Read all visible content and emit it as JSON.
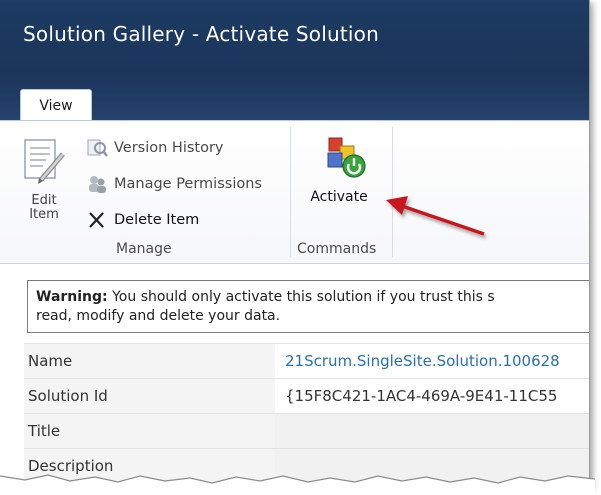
{
  "header": {
    "title": "Solution Gallery - Activate Solution",
    "active_tab": "View"
  },
  "ribbon": {
    "manage_group": {
      "edit_item_label": "Edit Item",
      "version_history_label": "Version History",
      "manage_permissions_label": "Manage Permissions",
      "delete_item_label": "Delete Item",
      "group_label": "Manage"
    },
    "commands_group": {
      "activate_label": "Activate",
      "group_label": "Commands"
    }
  },
  "warning": {
    "prefix": "Warning:",
    "line1": " You should only activate this solution if you trust this s",
    "line2": "read, modify and delete your data."
  },
  "properties": [
    {
      "label": "Name",
      "value": "21Scrum.SingleSite.Solution.100628"
    },
    {
      "label": "Solution Id",
      "value": "{15F8C421-1AC4-469A-9E41-11C55"
    },
    {
      "label": "Title",
      "value": ""
    },
    {
      "label": "Description",
      "value": ""
    }
  ],
  "colors": {
    "header_bg": "#1b355a",
    "link": "#2a6fb3",
    "annotation_arrow": "#c8191c"
  },
  "icons": [
    "edit-item-icon",
    "version-history-icon",
    "manage-permissions-icon",
    "delete-x-icon",
    "activate-icon",
    "annotation-arrow"
  ]
}
